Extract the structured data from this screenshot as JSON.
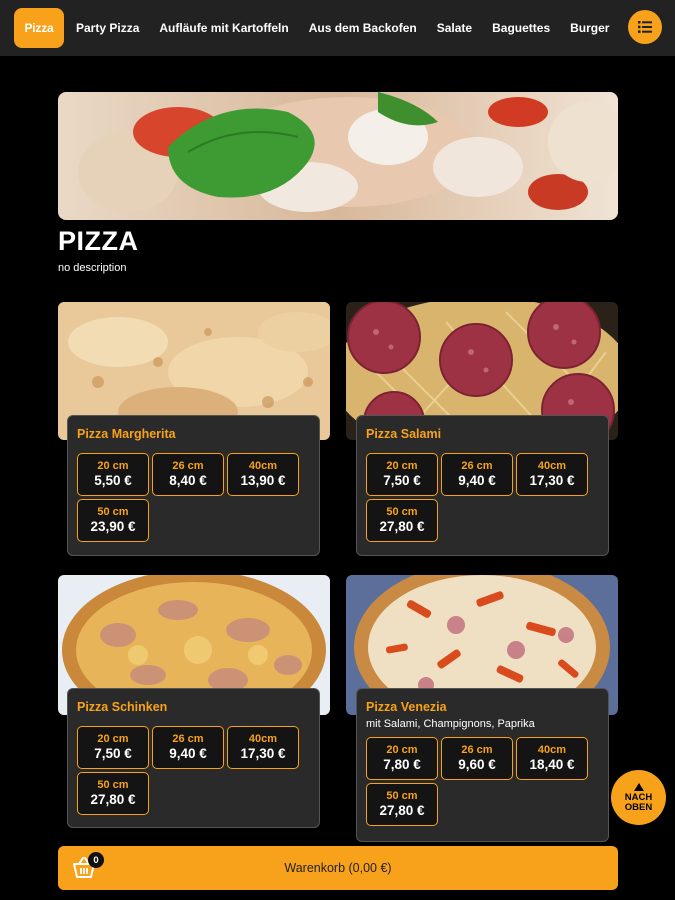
{
  "nav": {
    "active": "Pizza",
    "items": [
      "Party Pizza",
      "Aufläufe mit Kartoffeln",
      "Aus dem Backofen",
      "Salate",
      "Baguettes",
      "Burger"
    ]
  },
  "section": {
    "title": "PIZZA",
    "description": "no description"
  },
  "products": [
    {
      "name": "Pizza Margherita",
      "description": "",
      "prices": [
        {
          "size": "20 cm",
          "price": "5,50 €"
        },
        {
          "size": "26 cm",
          "price": "8,40 €"
        },
        {
          "size": "40cm",
          "price": "13,90 €"
        },
        {
          "size": "50 cm",
          "price": "23,90 €"
        }
      ]
    },
    {
      "name": "Pizza Salami",
      "description": "",
      "prices": [
        {
          "size": "20 cm",
          "price": "7,50 €"
        },
        {
          "size": "26 cm",
          "price": "9,40 €"
        },
        {
          "size": "40cm",
          "price": "17,30 €"
        },
        {
          "size": "50 cm",
          "price": "27,80 €"
        }
      ]
    },
    {
      "name": "Pizza Schinken",
      "description": "",
      "prices": [
        {
          "size": "20 cm",
          "price": "7,50 €"
        },
        {
          "size": "26 cm",
          "price": "9,40 €"
        },
        {
          "size": "40cm",
          "price": "17,30 €"
        },
        {
          "size": "50 cm",
          "price": "27,80 €"
        }
      ]
    },
    {
      "name": "Pizza Venezia",
      "description": "mit Salami, Champignons, Paprika",
      "prices": [
        {
          "size": "20 cm",
          "price": "7,80 €"
        },
        {
          "size": "26 cm",
          "price": "9,60 €"
        },
        {
          "size": "40cm",
          "price": "18,40 €"
        },
        {
          "size": "50 cm",
          "price": "27,80 €"
        }
      ]
    }
  ],
  "back_to_top": {
    "line1": "NACH",
    "line2": "OBEN"
  },
  "cart": {
    "label": "Warenkorb (0,00 €)",
    "count": "0"
  },
  "colors": {
    "accent": "#f7a21a",
    "background": "#000000",
    "card": "#2a2a2a",
    "nav": "#222222"
  },
  "icons": {
    "menu": "list-icon",
    "cart": "basket-icon",
    "back_to_top": "arrow-up-icon"
  }
}
